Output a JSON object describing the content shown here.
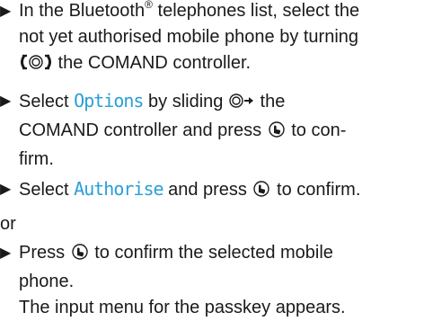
{
  "steps": [
    {
      "line1_a": "In the Bluetooth",
      "line1_reg": "®",
      "line1_b": " telephones list, select the",
      "line2": "not yet authorised mobile phone by turning",
      "line3": " the COMAND controller."
    },
    {
      "line1_a": "Select ",
      "line1_term": "Options",
      "line1_b": " by sliding ",
      "line2": "COMAND controller and press ",
      "line2_b": " to con-",
      "line3": "firm.",
      "line1_c": " the"
    },
    {
      "line1_a": "Select ",
      "line1_term": "Authorise",
      "line1_b": " and press ",
      "line1_c": " to confirm."
    }
  ],
  "or_text": "or",
  "step4": {
    "line1_a": "Press ",
    "line1_b": " to confirm the selected mobile",
    "line2": "phone.",
    "result": "The input menu for the passkey appears."
  },
  "icons": {
    "arrow": "triangle-right-icon",
    "turn": "controller-turn-icon",
    "slide": "controller-slide-right-icon",
    "press": "controller-press-icon"
  },
  "colors": {
    "menu_term": "#2a9fd6",
    "text": "#1a1a1a"
  }
}
